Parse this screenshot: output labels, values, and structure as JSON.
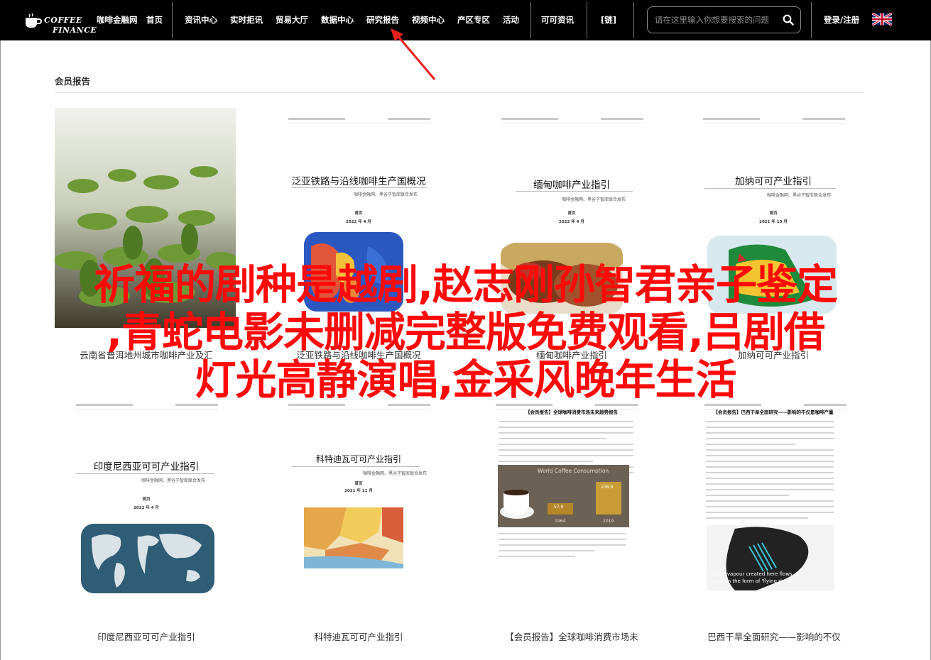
{
  "brand": {
    "line1": "COFFEE",
    "line2": "FINANCE"
  },
  "nav": {
    "items": [
      "咖啡金融网",
      "首页",
      "资讯中心",
      "实时拒讯",
      "贸易大厅",
      "数据中心",
      "研究报告",
      "视频中心",
      "产区专区",
      "活动",
      "可可资讯",
      "[链]"
    ],
    "login": "登录/注册"
  },
  "search": {
    "placeholder": "请在这里输入你想要搜索的问题"
  },
  "section": {
    "title": "会员报告"
  },
  "cards": [
    {
      "caption": "云南省普洱地州城市咖啡产业及汇"
    },
    {
      "title": "泛亚铁路与沿线咖啡生产国概况",
      "sub": "咖啡金融网、黑谷子智库联合发布",
      "date": "2022 年 4 月",
      "caption": "泛亚铁路与沿线咖啡生产国概况"
    },
    {
      "title": "缅甸咖啡产业指引",
      "sub": "咖啡金融网、黑谷子智库联合发布",
      "date": "2022 年 4 月",
      "caption": "缅甸咖啡产业指引"
    },
    {
      "title": "加纳可可产业指引",
      "sub": "咖啡金融网、黑谷子智库联合发布",
      "date": "2021 年 10 月",
      "caption": "加纳可可产业指引"
    },
    {
      "title": "印度尼西亚可可产业指引",
      "sub": "咖啡金融网、黑谷子智库联合发布",
      "date": "2022 年 4 月",
      "caption": "印度尼西亚可可产业指引"
    },
    {
      "title": "科特迪瓦可可产业指引",
      "sub": "咖啡金融网、黑谷子智库联合发布",
      "date": "2021 年 11 月",
      "caption": "科特迪瓦可可产业指引"
    },
    {
      "title": "【会员报告】全球咖啡消费市场未来趋势报告",
      "chart_title": "World Coffee Consumption",
      "v1": "57,9",
      "v2": "108,9",
      "y1": "1964",
      "y2": "2019",
      "caption": "【会员报告】全球咖啡消费市场未"
    },
    {
      "title": "【会员报告】巴西干旱全面研究——影响的不仅是咖啡产量",
      "map_text1": "Water vapour created here flows",
      "map_text2": "south in the form of 'flying rivers'.",
      "caption": "巴西干旱全面研究——影响的不仅"
    }
  ],
  "headline": {
    "line1": "祈福的剧种是越剧,赵志刚孙智君亲子鉴定",
    "line2": ",青蛇电影未删减完整版免费观看,吕剧借",
    "line3": "灯光高静演唱,金采风晚年生活"
  },
  "colors": {
    "topbar": "#000000",
    "headline": "#ff0a0a",
    "arrow": "#e8211c"
  }
}
